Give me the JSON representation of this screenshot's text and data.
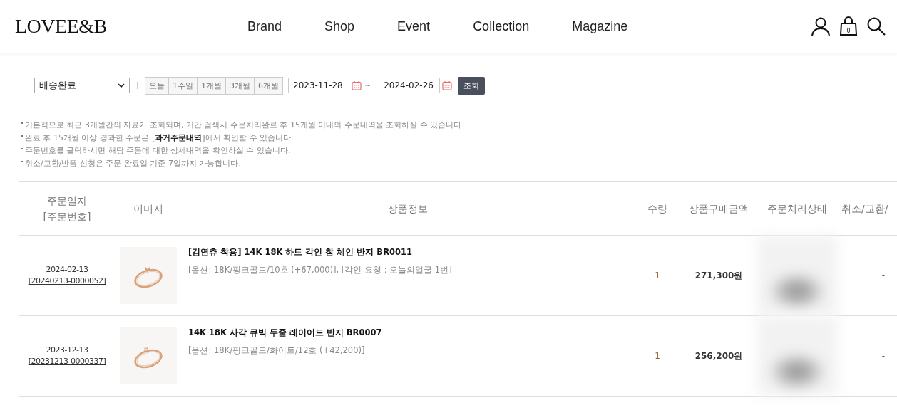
{
  "header": {
    "logo": "LOVEE&B",
    "nav": [
      "Brand",
      "Shop",
      "Event",
      "Collection",
      "Magazine"
    ],
    "cart_count": "0"
  },
  "filter": {
    "status": "배송완료",
    "periods": [
      "오늘",
      "1주일",
      "1개월",
      "3개월",
      "6개월"
    ],
    "date_from": "2023-11-28",
    "separator": "~",
    "date_to": "2024-02-26",
    "search_button": "조회"
  },
  "notes": [
    "기본적으로 최근 3개월간의 자료가 조회되며, 기간 검색시 주문처리완료 후 15개월 이내의 주문내역을 조회하실 수 있습니다.",
    "완료 후 15개월 이상 경과한 주문은 [**과거주문내역**]에서 확인할 수 있습니다.",
    "주문번호를 클릭하시면 해당 주문에 대한 상세내역을 확인하실 수 있습니다.",
    "취소/교환/반품 신청은 주문 완료일 기준 7일까지 가능합니다."
  ],
  "table": {
    "columns": [
      {
        "lines": [
          "주문일자",
          "[주문번호]"
        ]
      },
      {
        "lines": [
          "이미지"
        ]
      },
      {
        "lines": [
          "상품정보"
        ]
      },
      {
        "lines": [
          "수량"
        ]
      },
      {
        "lines": [
          "상품구매금액"
        ]
      },
      {
        "lines": [
          "주문처리상태"
        ]
      },
      {
        "lines": [
          "취소/교환/"
        ]
      }
    ],
    "rows": [
      {
        "date": "2024-02-13",
        "order_no": "[20240213-0000052]",
        "title": "[김연츄 착용] 14K 18K 하트 각인 참 체인 반지 BR0011",
        "options": "[옵션: 18K/핑크골드/10호 (+67,000)], [각인 요청 : 오늘의얼굴 1번]",
        "qty": "1",
        "amount": "271,300원",
        "cancel": "-"
      },
      {
        "date": "2023-12-13",
        "order_no": "[20231213-0000337]",
        "title": "14K 18K 사각 큐빅 두줄 레이어드 반지 BR0007",
        "options": "[옵션: 18K/핑크골드/화이트/12호 (+42,200)]",
        "qty": "1",
        "amount": "256,200원",
        "cancel": "-"
      }
    ]
  }
}
